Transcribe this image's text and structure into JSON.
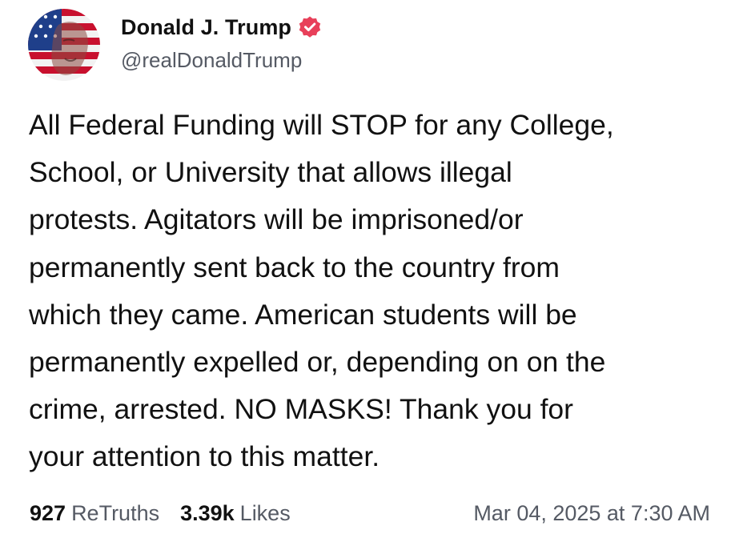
{
  "author": {
    "display_name": "Donald J. Trump",
    "handle": "@realDonaldTrump",
    "verified_icon": "verified-badge-icon",
    "badge_color": "#e8405a"
  },
  "post": {
    "text": "All Federal Funding will STOP for any College,\nSchool, or University that allows illegal\nprotests. Agitators will be imprisoned/or\npermanently sent back to the country from\nwhich they came. American students will be\npermanently expelled or, depending on on the\ncrime, arrested. NO MASKS! Thank you for\nyour attention to this matter."
  },
  "stats": {
    "retruths_count": "927",
    "retruths_label": "ReTruths",
    "likes_count": "3.39k",
    "likes_label": "Likes"
  },
  "timestamp": "Mar 04, 2025 at 7:30 AM"
}
